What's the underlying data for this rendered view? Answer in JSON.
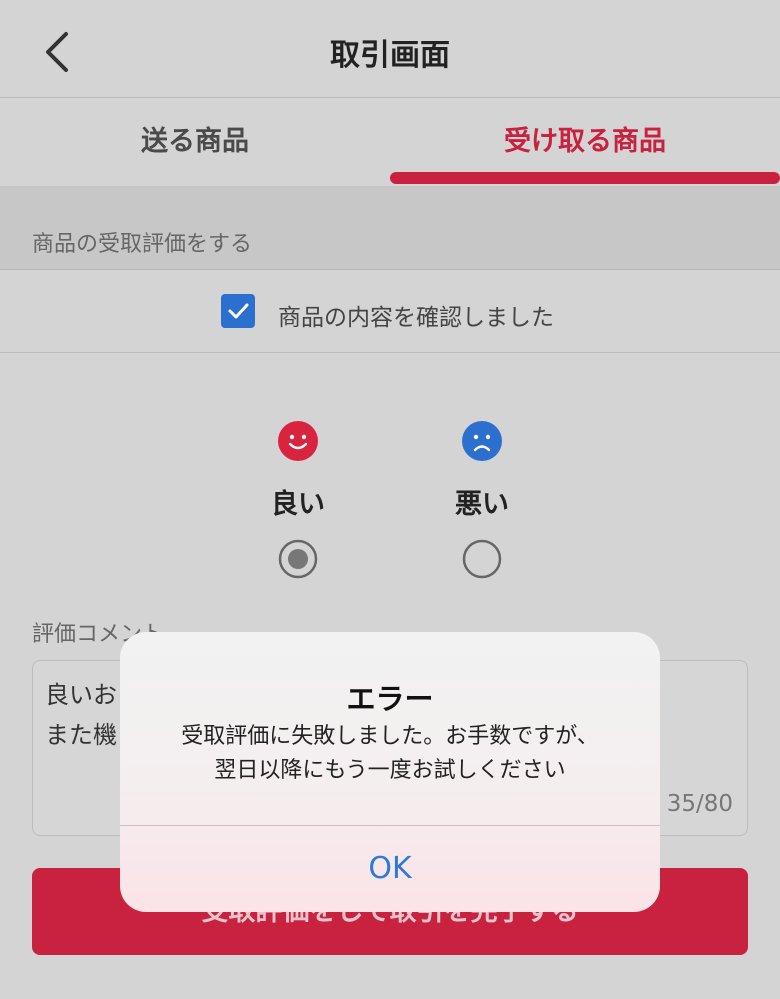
{
  "header": {
    "title": "取引画面"
  },
  "tabs": {
    "send": "送る商品",
    "receive": "受け取る商品"
  },
  "section": {
    "title": "商品の受取評価をする"
  },
  "confirm": {
    "label": "商品の内容を確認しました",
    "checked": true
  },
  "rating": {
    "good_label": "良い",
    "bad_label": "悪い",
    "selected": "good",
    "good_color": "#d9243f",
    "bad_color": "#2c6fcf"
  },
  "comment": {
    "label": "評価コメント",
    "text": "良いお\nまた機",
    "counter": "35/80"
  },
  "submit": {
    "label": "受取評価をして取引を完了する"
  },
  "alert": {
    "title": "エラー",
    "message_line1": "受取評価に失敗しました。お手数ですが、",
    "message_line2": "翌日以降にもう一度お試しください",
    "ok_label": "OK"
  },
  "colors": {
    "accent": "#c8223f",
    "link": "#2e7ad8"
  }
}
